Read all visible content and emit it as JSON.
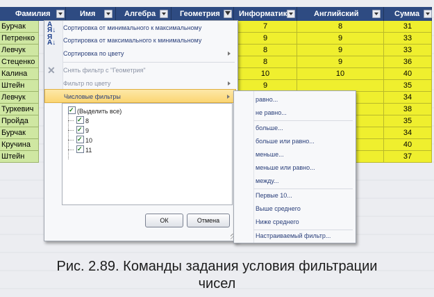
{
  "columns": [
    {
      "label": "Фамилия",
      "filtered": false
    },
    {
      "label": "Имя",
      "filtered": false
    },
    {
      "label": "Алгебра",
      "filtered": false
    },
    {
      "label": "Геометрия",
      "filtered": true
    },
    {
      "label": "Информатика",
      "filtered": false
    },
    {
      "label": "Английский",
      "filtered": false
    },
    {
      "label": "Сумма",
      "filtered": false
    }
  ],
  "rows": [
    {
      "name": "Бурчак",
      "inf": "7",
      "eng": "8",
      "sum": "31"
    },
    {
      "name": "Петренко",
      "inf": "9",
      "eng": "9",
      "sum": "33"
    },
    {
      "name": "Левчук",
      "inf": "8",
      "eng": "9",
      "sum": "33"
    },
    {
      "name": "Стеценко",
      "inf": "8",
      "eng": "9",
      "sum": "36"
    },
    {
      "name": "Калина",
      "inf": "10",
      "eng": "10",
      "sum": "40"
    },
    {
      "name": "Штейн",
      "inf": "9",
      "eng": "",
      "sum": "35"
    },
    {
      "name": "Левчук",
      "inf": "",
      "eng": "",
      "sum": "34"
    },
    {
      "name": "Туркевич",
      "inf": "",
      "eng": "",
      "sum": "38"
    },
    {
      "name": "Пройда",
      "inf": "",
      "eng": "",
      "sum": "35"
    },
    {
      "name": "Бурчак",
      "inf": "",
      "eng": "",
      "sum": "34"
    },
    {
      "name": "Кручинa",
      "inf": "",
      "eng": "",
      "sum": "40"
    },
    {
      "name": "Штейн",
      "inf": "",
      "eng": "",
      "sum": "37"
    }
  ],
  "menu": {
    "sort_asc": "Сортировка от минимального к максимальному",
    "sort_desc": "Сортировка от максимального к минимальному",
    "sort_color": "Сортировка по цвету",
    "clear_filter": "Снять фильтр с \"Геометрия\"",
    "filter_color": "Фильтр по цвету",
    "number_filters": "Числовые фильтры",
    "select_all": "(Выделить все)",
    "values": [
      "8",
      "9",
      "10",
      "11"
    ],
    "ok": "ОК",
    "cancel": "Отмена"
  },
  "submenu": {
    "items": [
      "равно...",
      "не равно...",
      "больше...",
      "больше или равно...",
      "меньше...",
      "меньше или равно...",
      "между...",
      "Первые 10...",
      "Выше среднего",
      "Ниже среднего",
      "Настраиваемый фильтр..."
    ]
  },
  "caption": {
    "line1": "Рис. 2.89. Команды задания условия фильтрации",
    "line2": "чисел"
  }
}
